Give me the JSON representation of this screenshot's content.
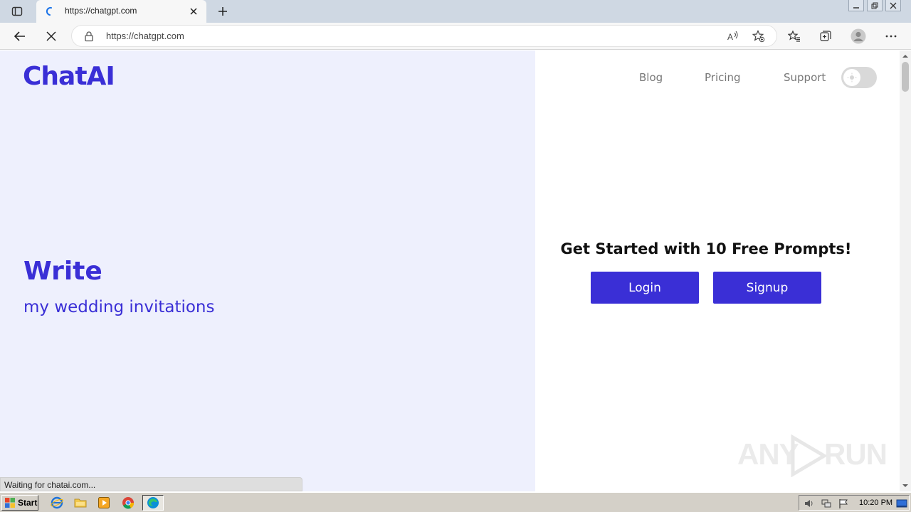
{
  "browser": {
    "tab_title": "https://chatgpt.com",
    "url": "https://chatgpt.com",
    "status_text": "Waiting for chatai.com..."
  },
  "site": {
    "logo": "ChatAI",
    "nav": [
      "Blog",
      "Pricing",
      "Support"
    ],
    "hero_title": "Write",
    "hero_subtitle": "my wedding invitations",
    "cta_title": "Get Started with 10 Free Prompts!",
    "login_label": "Login",
    "signup_label": "Signup",
    "brand_color": "#3a2fd6",
    "panel_color": "#eef0fd"
  },
  "watermark": {
    "left": "ANY",
    "right": "RUN"
  },
  "taskbar": {
    "start_label": "Start",
    "clock": "10:20 PM"
  }
}
